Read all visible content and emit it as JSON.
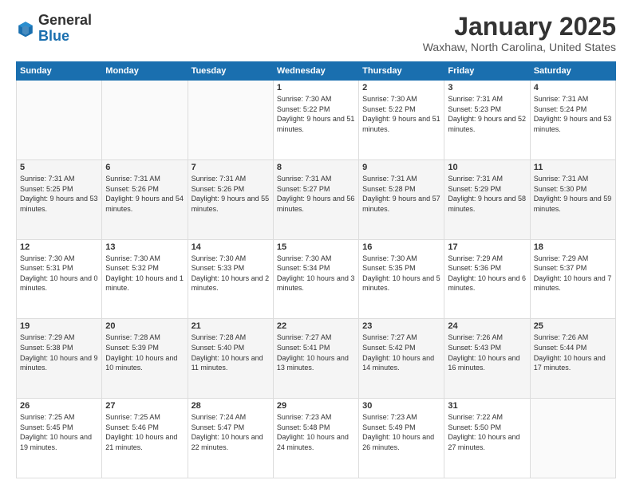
{
  "header": {
    "logo_general": "General",
    "logo_blue": "Blue",
    "month_year": "January 2025",
    "location": "Waxhaw, North Carolina, United States"
  },
  "days_of_week": [
    "Sunday",
    "Monday",
    "Tuesday",
    "Wednesday",
    "Thursday",
    "Friday",
    "Saturday"
  ],
  "weeks": [
    {
      "row_class": "row-odd",
      "days": [
        {
          "num": "",
          "info": "",
          "empty": true
        },
        {
          "num": "",
          "info": "",
          "empty": true
        },
        {
          "num": "",
          "info": "",
          "empty": true
        },
        {
          "num": "1",
          "info": "Sunrise: 7:30 AM\nSunset: 5:22 PM\nDaylight: 9 hours\nand 51 minutes."
        },
        {
          "num": "2",
          "info": "Sunrise: 7:30 AM\nSunset: 5:22 PM\nDaylight: 9 hours\nand 51 minutes."
        },
        {
          "num": "3",
          "info": "Sunrise: 7:31 AM\nSunset: 5:23 PM\nDaylight: 9 hours\nand 52 minutes."
        },
        {
          "num": "4",
          "info": "Sunrise: 7:31 AM\nSunset: 5:24 PM\nDaylight: 9 hours\nand 53 minutes."
        }
      ]
    },
    {
      "row_class": "row-even",
      "days": [
        {
          "num": "5",
          "info": "Sunrise: 7:31 AM\nSunset: 5:25 PM\nDaylight: 9 hours\nand 53 minutes."
        },
        {
          "num": "6",
          "info": "Sunrise: 7:31 AM\nSunset: 5:26 PM\nDaylight: 9 hours\nand 54 minutes."
        },
        {
          "num": "7",
          "info": "Sunrise: 7:31 AM\nSunset: 5:26 PM\nDaylight: 9 hours\nand 55 minutes."
        },
        {
          "num": "8",
          "info": "Sunrise: 7:31 AM\nSunset: 5:27 PM\nDaylight: 9 hours\nand 56 minutes."
        },
        {
          "num": "9",
          "info": "Sunrise: 7:31 AM\nSunset: 5:28 PM\nDaylight: 9 hours\nand 57 minutes."
        },
        {
          "num": "10",
          "info": "Sunrise: 7:31 AM\nSunset: 5:29 PM\nDaylight: 9 hours\nand 58 minutes."
        },
        {
          "num": "11",
          "info": "Sunrise: 7:31 AM\nSunset: 5:30 PM\nDaylight: 9 hours\nand 59 minutes."
        }
      ]
    },
    {
      "row_class": "row-odd",
      "days": [
        {
          "num": "12",
          "info": "Sunrise: 7:30 AM\nSunset: 5:31 PM\nDaylight: 10 hours\nand 0 minutes."
        },
        {
          "num": "13",
          "info": "Sunrise: 7:30 AM\nSunset: 5:32 PM\nDaylight: 10 hours\nand 1 minute."
        },
        {
          "num": "14",
          "info": "Sunrise: 7:30 AM\nSunset: 5:33 PM\nDaylight: 10 hours\nand 2 minutes."
        },
        {
          "num": "15",
          "info": "Sunrise: 7:30 AM\nSunset: 5:34 PM\nDaylight: 10 hours\nand 3 minutes."
        },
        {
          "num": "16",
          "info": "Sunrise: 7:30 AM\nSunset: 5:35 PM\nDaylight: 10 hours\nand 5 minutes."
        },
        {
          "num": "17",
          "info": "Sunrise: 7:29 AM\nSunset: 5:36 PM\nDaylight: 10 hours\nand 6 minutes."
        },
        {
          "num": "18",
          "info": "Sunrise: 7:29 AM\nSunset: 5:37 PM\nDaylight: 10 hours\nand 7 minutes."
        }
      ]
    },
    {
      "row_class": "row-even",
      "days": [
        {
          "num": "19",
          "info": "Sunrise: 7:29 AM\nSunset: 5:38 PM\nDaylight: 10 hours\nand 9 minutes."
        },
        {
          "num": "20",
          "info": "Sunrise: 7:28 AM\nSunset: 5:39 PM\nDaylight: 10 hours\nand 10 minutes."
        },
        {
          "num": "21",
          "info": "Sunrise: 7:28 AM\nSunset: 5:40 PM\nDaylight: 10 hours\nand 11 minutes."
        },
        {
          "num": "22",
          "info": "Sunrise: 7:27 AM\nSunset: 5:41 PM\nDaylight: 10 hours\nand 13 minutes."
        },
        {
          "num": "23",
          "info": "Sunrise: 7:27 AM\nSunset: 5:42 PM\nDaylight: 10 hours\nand 14 minutes."
        },
        {
          "num": "24",
          "info": "Sunrise: 7:26 AM\nSunset: 5:43 PM\nDaylight: 10 hours\nand 16 minutes."
        },
        {
          "num": "25",
          "info": "Sunrise: 7:26 AM\nSunset: 5:44 PM\nDaylight: 10 hours\nand 17 minutes."
        }
      ]
    },
    {
      "row_class": "row-odd",
      "days": [
        {
          "num": "26",
          "info": "Sunrise: 7:25 AM\nSunset: 5:45 PM\nDaylight: 10 hours\nand 19 minutes."
        },
        {
          "num": "27",
          "info": "Sunrise: 7:25 AM\nSunset: 5:46 PM\nDaylight: 10 hours\nand 21 minutes."
        },
        {
          "num": "28",
          "info": "Sunrise: 7:24 AM\nSunset: 5:47 PM\nDaylight: 10 hours\nand 22 minutes."
        },
        {
          "num": "29",
          "info": "Sunrise: 7:23 AM\nSunset: 5:48 PM\nDaylight: 10 hours\nand 24 minutes."
        },
        {
          "num": "30",
          "info": "Sunrise: 7:23 AM\nSunset: 5:49 PM\nDaylight: 10 hours\nand 26 minutes."
        },
        {
          "num": "31",
          "info": "Sunrise: 7:22 AM\nSunset: 5:50 PM\nDaylight: 10 hours\nand 27 minutes."
        },
        {
          "num": "",
          "info": "",
          "empty": true
        }
      ]
    }
  ]
}
